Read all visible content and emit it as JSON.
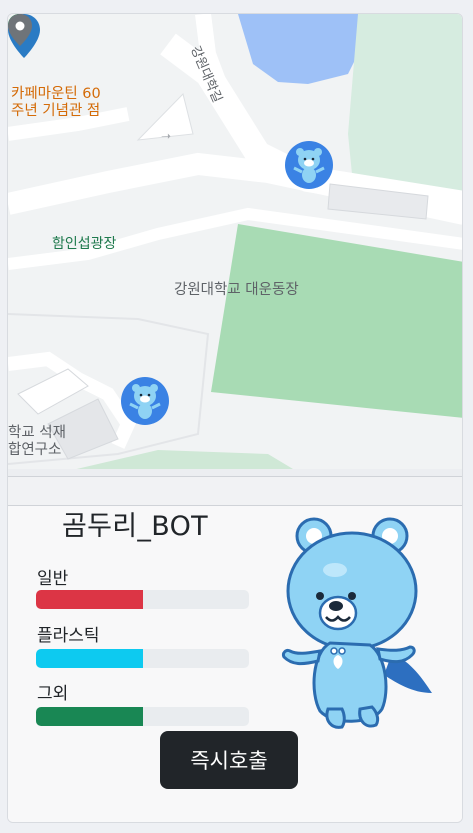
{
  "map": {
    "places": {
      "cafe_line1": "카페마운틴 60",
      "cafe_line2": "주년 기념관 점",
      "plaza": "함인섭광장",
      "stadium": "강원대학교 대운동장",
      "lab_line1": "학교 석재",
      "lab_line2": "합연구소",
      "road": "강원대학길"
    },
    "icons": {
      "bot_marker": "bear-mascot-marker-icon",
      "location_pin": "map-pin-icon",
      "park": "tree-icon",
      "place": "gray-pin-icon",
      "direction": "arrow-icon"
    }
  },
  "panel": {
    "bot_name": "곰두리_BOT",
    "gauges": [
      {
        "label": "일반",
        "level_percent": 50,
        "color": "#dc3545"
      },
      {
        "label": "플라스틱",
        "level_percent": 50,
        "color": "#0dcaf0"
      },
      {
        "label": "그외",
        "level_percent": 50,
        "color": "#198754"
      }
    ],
    "call_button": "즉시호출",
    "mascot_icon": "bear-mascot-icon"
  },
  "colors": {
    "marker_blue": "#3a82e4",
    "button_dark": "#212529",
    "park_green": "#a8dbb4"
  }
}
